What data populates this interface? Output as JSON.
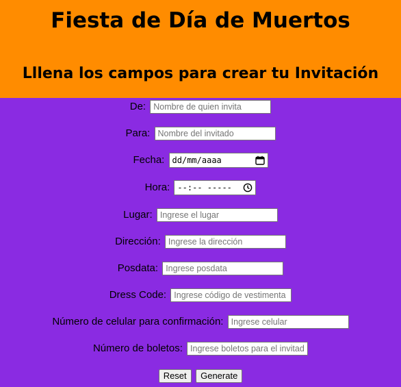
{
  "header": {
    "title": "Fiesta de Día de Muertos",
    "subtitle": "Lllena los campos para crear tu Invitación"
  },
  "form": {
    "de": {
      "label": "De:",
      "placeholder": "Nombre de quien invita"
    },
    "para": {
      "label": "Para:",
      "placeholder": "Nombre del invitado"
    },
    "fecha": {
      "label": "Fecha:",
      "placeholder": "dd/mm/aaaa"
    },
    "hora": {
      "label": "Hora:",
      "placeholder": "--:-- -----"
    },
    "lugar": {
      "label": "Lugar:",
      "placeholder": "Ingrese el lugar"
    },
    "direccion": {
      "label": "Dirección:",
      "placeholder": "Ingrese la dirección"
    },
    "posdata": {
      "label": "Posdata:",
      "placeholder": "Ingrese posdata"
    },
    "dress_code": {
      "label": "Dress Code:",
      "placeholder": "Ingrese código de vestimenta"
    },
    "celular": {
      "label": "Número de celular para confirmación:",
      "placeholder": "Ingrese celular"
    },
    "boletos": {
      "label": "Número de boletos:",
      "placeholder": "Ingrese boletos para el invitado"
    }
  },
  "buttons": {
    "reset": "Reset",
    "generate": "Generate"
  },
  "icons": {
    "calendar": "calendar-icon",
    "clock": "clock-icon"
  },
  "colors": {
    "header_bg": "#ff8c00",
    "body_bg": "#8a2be2"
  }
}
